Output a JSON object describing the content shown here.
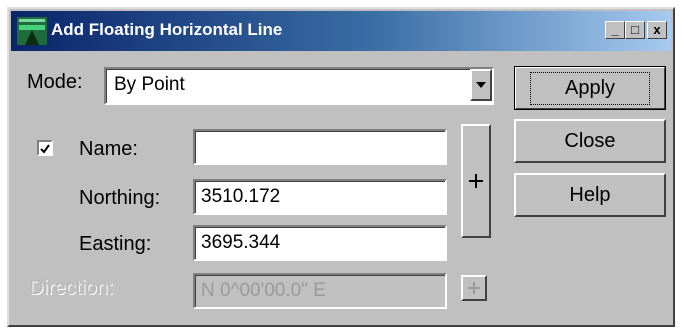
{
  "window": {
    "title": "Add Floating Horizontal Line",
    "minimize_label": "_",
    "maximize_label": "□",
    "close_label": "x"
  },
  "mode": {
    "label": "Mode:",
    "value": "By Point"
  },
  "name": {
    "label": "Name:",
    "checked": true,
    "value": ""
  },
  "northing": {
    "label": "Northing:",
    "value": "3510.172"
  },
  "easting": {
    "label": "Easting:",
    "value": "3695.344"
  },
  "direction": {
    "label": "Direction:",
    "value": "N  0^00'00.0\" E"
  },
  "buttons": {
    "apply": "Apply",
    "close": "Close",
    "help": "Help"
  },
  "icons": {
    "app": "horizontal-line-app-icon",
    "pick": "crosshair-pick-icon",
    "dropdown": "chevron-down-icon"
  }
}
